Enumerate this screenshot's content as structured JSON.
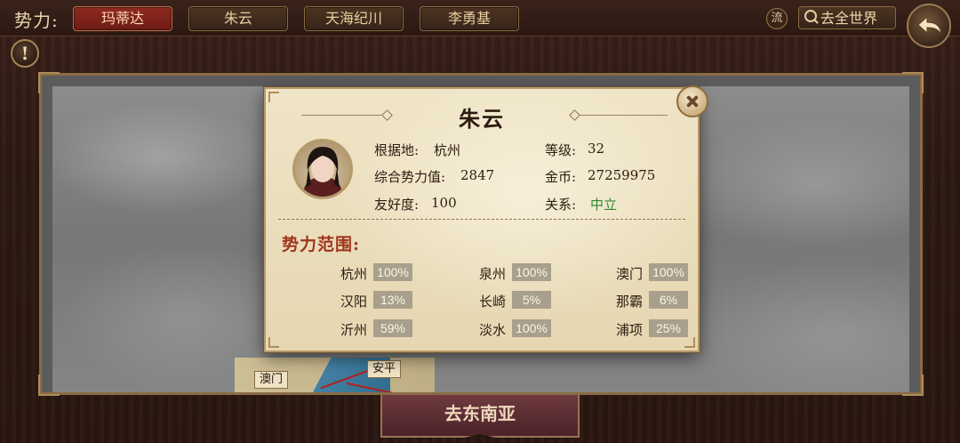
{
  "topbar": {
    "faction_label": "势力:",
    "tabs": [
      {
        "label": "玛蒂达",
        "active": true
      },
      {
        "label": "朱云",
        "active": false
      },
      {
        "label": "天海纪川",
        "active": false
      },
      {
        "label": "李勇基",
        "active": false
      }
    ],
    "flow_label": "流",
    "world_button": "去全世界"
  },
  "map": {
    "labels": [
      "澳门",
      "安平"
    ],
    "go_button": "去东南亚"
  },
  "popup": {
    "title": "朱云",
    "base_label": "根据地:",
    "base_value": "杭州",
    "power_label": "综合势力值:",
    "power_value": "2847",
    "friendship_label": "友好度:",
    "friendship_value": "100",
    "level_label": "等级:",
    "level_value": "32",
    "gold_label": "金币:",
    "gold_value": "27259975",
    "relation_label": "关系:",
    "relation_value": "中立",
    "relation_color": "#2e8b2e",
    "range_title": "势力范围:",
    "territories": [
      {
        "city": "杭州",
        "pct": "100%"
      },
      {
        "city": "泉州",
        "pct": "100%"
      },
      {
        "city": "澳门",
        "pct": "100%"
      },
      {
        "city": "汉阳",
        "pct": "13%"
      },
      {
        "city": "长崎",
        "pct": "5%"
      },
      {
        "city": "那霸",
        "pct": "6%"
      },
      {
        "city": "沂州",
        "pct": "59%"
      },
      {
        "city": "淡水",
        "pct": "100%"
      },
      {
        "city": "浦项",
        "pct": "25%"
      }
    ]
  },
  "icons": [
    "search-icon",
    "back-arrow-icon",
    "alert-icon",
    "close-icon",
    "avatar-portrait"
  ]
}
